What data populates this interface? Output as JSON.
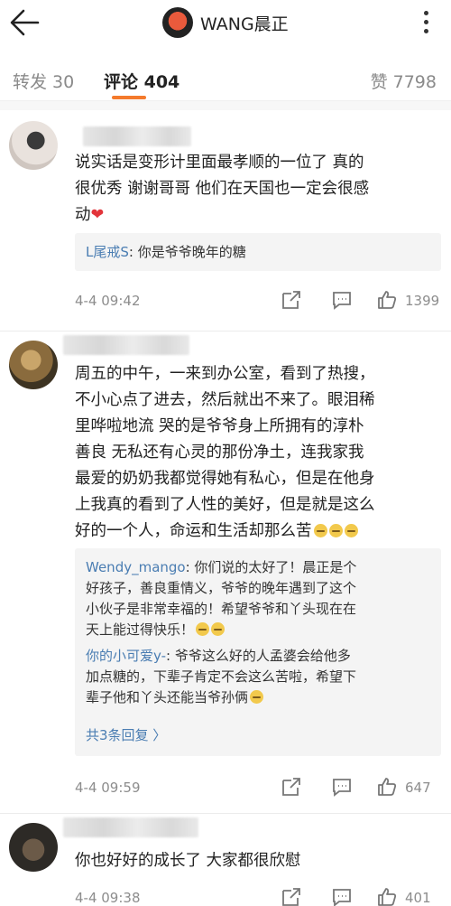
{
  "header": {
    "title": "WANG晨正"
  },
  "tabs": {
    "repost": "转发 30",
    "comment": "评论 404",
    "like": "赞 7798"
  },
  "colors": {
    "accent": "#f47a2c",
    "link": "#4a7db2",
    "heart": "#e2343a"
  },
  "comments": [
    {
      "lines": [
        "说实话是变形计里面最孝顺的一位了 真的",
        "很优秀 谢谢哥哥 他们在天国也一定会很感",
        "动"
      ],
      "heart": "❤",
      "reply": {
        "name": "L尾戒S",
        "text": ": 你是爷爷晚年的糖"
      },
      "time": "4-4 09:42",
      "likes": "1399"
    },
    {
      "lines": [
        "周五的中午，一来到办公室，看到了热搜，",
        "不小心点了进去，然后就出不来了。眼泪稀",
        "里哗啦地流 哭的是爷爷身上所拥有的淳朴",
        "善良 无私还有心灵的那份净土，连我家我",
        "最爱的奶奶我都觉得她有私心，但是在他身",
        "上我真的看到了人性的美好，但是就是这么",
        "好的一个人，命运和生活却那么苦"
      ],
      "replies": [
        {
          "name": "Wendy_mango",
          "lines": [
            ": 你们说的太好了！晨正是个",
            "好孩子，善良重情义，爷爷的晚年遇到了这个",
            "小伙子是非常幸福的！希望爷爷和丫头现在在",
            "天上能过得快乐！"
          ]
        },
        {
          "name": "你的小可爱y-",
          "lines": [
            ": 爷爷这么好的人孟婆会给他多",
            "加点糖的，下辈子肯定不会这么苦啦，希望下",
            "辈子他和丫头还能当爷孙俩"
          ]
        }
      ],
      "more_replies": "共3条回复 〉",
      "time": "4-4 09:59",
      "likes": "647"
    },
    {
      "lines": [
        "你也好好的成长了 大家都很欣慰"
      ],
      "time": "4-4 09:38",
      "likes": "401"
    }
  ]
}
